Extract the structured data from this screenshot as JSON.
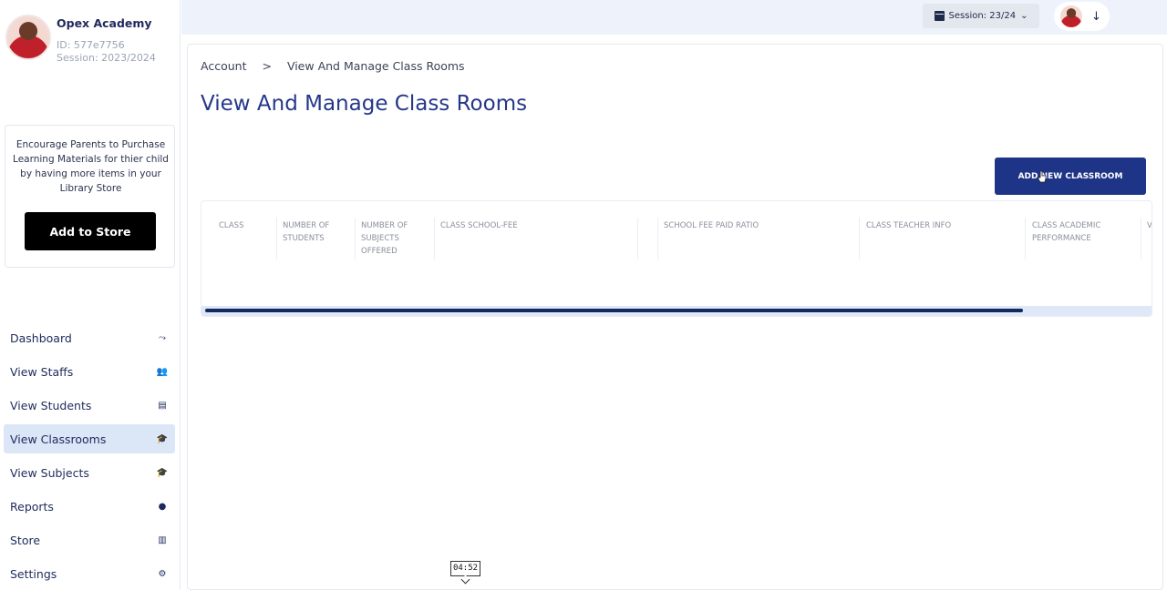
{
  "profile": {
    "org_name": "Opex Academy",
    "id_text": "ID: 577e7756",
    "session_text": "Session: 2023/2024"
  },
  "promo": {
    "text": "Encourage Parents to Purchase Learning Materials for thier child by having more items in your Library Store",
    "button_label": "Add to Store"
  },
  "nav": {
    "items": [
      {
        "label": "Dashboard",
        "icon": "chart-icon",
        "glyph": "⤳"
      },
      {
        "label": "View Staffs",
        "icon": "users-icon",
        "glyph": "👥"
      },
      {
        "label": "View Students",
        "icon": "id-card-icon",
        "glyph": "▤"
      },
      {
        "label": "View Classrooms",
        "icon": "graduation-cap-icon",
        "glyph": "🎓",
        "active": true
      },
      {
        "label": "View Subjects",
        "icon": "graduation-cap-icon",
        "glyph": "🎓"
      },
      {
        "label": "Reports",
        "icon": "info-icon",
        "glyph": "●"
      },
      {
        "label": "Store",
        "icon": "store-icon",
        "glyph": "▥"
      },
      {
        "label": "Settings",
        "icon": "gear-icon",
        "glyph": "⚙"
      }
    ]
  },
  "topbar": {
    "session_label": "Session: 23/24"
  },
  "breadcrumb": {
    "root": "Account",
    "separator": ">",
    "current": "View And Manage Class Rooms"
  },
  "page": {
    "title": "View And Manage Class Rooms",
    "add_button_label": "ADD NEW CLASSROOM"
  },
  "table": {
    "columns": [
      "CLASS",
      "NUMBER OF STUDENTS",
      "NUMBER OF SUBJECTS OFFERED",
      "CLASS SCHOOL-FEE",
      "SCHOOL FEE PAID RATIO",
      "CLASS TEACHER INFO",
      "CLASS ACADEMIC PERFORMANCE",
      "V"
    ],
    "rows": []
  },
  "overlay": {
    "timestamp": "04:52"
  },
  "colors": {
    "brand_primary": "#1e3587",
    "title": "#25378a",
    "active_nav_bg": "#dbe6f7",
    "topbar_bg": "#eef3fb",
    "scrollbar_thumb": "#132a5e"
  }
}
